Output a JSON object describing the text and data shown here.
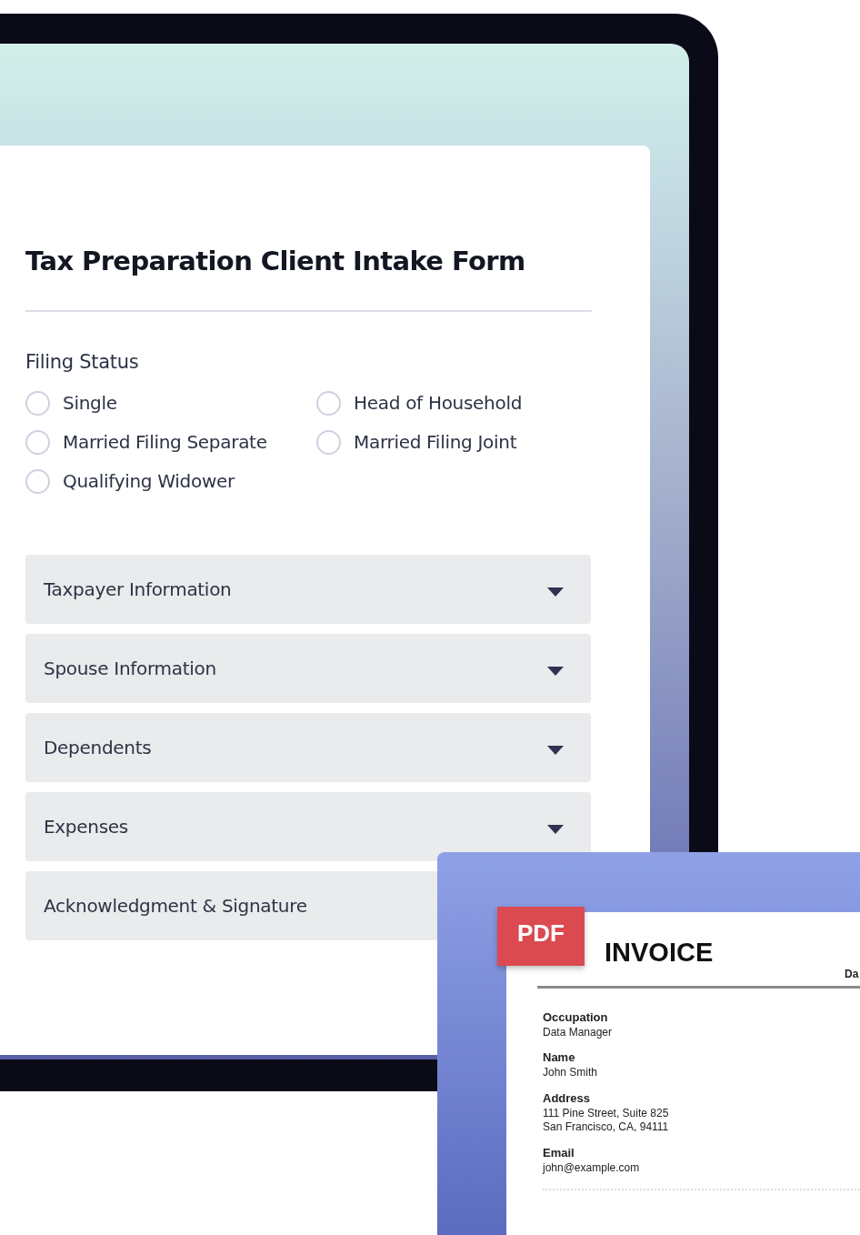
{
  "form": {
    "title": "Tax Preparation Client Intake Form",
    "filing_status": {
      "label": "Filing Status",
      "options": [
        {
          "label": "Single",
          "selected": false
        },
        {
          "label": "Head of Household",
          "selected": false
        },
        {
          "label": "Married Filing Separate",
          "selected": false
        },
        {
          "label": "Married Filing Joint",
          "selected": false
        },
        {
          "label": "Qualifying Widower",
          "selected": false
        }
      ]
    },
    "sections": [
      {
        "label": "Taxpayer Information",
        "caret": true
      },
      {
        "label": "Spouse Information",
        "caret": true
      },
      {
        "label": "Dependents",
        "caret": true
      },
      {
        "label": "Expenses",
        "caret": true
      },
      {
        "label": "Acknowledgment & Signature",
        "caret": false
      }
    ]
  },
  "invoice": {
    "badge": "PDF",
    "title": "INVOICE",
    "column_2_label": "Da",
    "fields": [
      {
        "label": "Occupation",
        "lines": [
          "Data Manager"
        ]
      },
      {
        "label": "Name",
        "lines": [
          "John Smith"
        ]
      },
      {
        "label": "Address",
        "lines": [
          "111 Pine Street, Suite 825",
          "San Francisco, CA, 94111"
        ]
      },
      {
        "label": "Email",
        "lines": [
          "john@example.com"
        ]
      }
    ]
  }
}
